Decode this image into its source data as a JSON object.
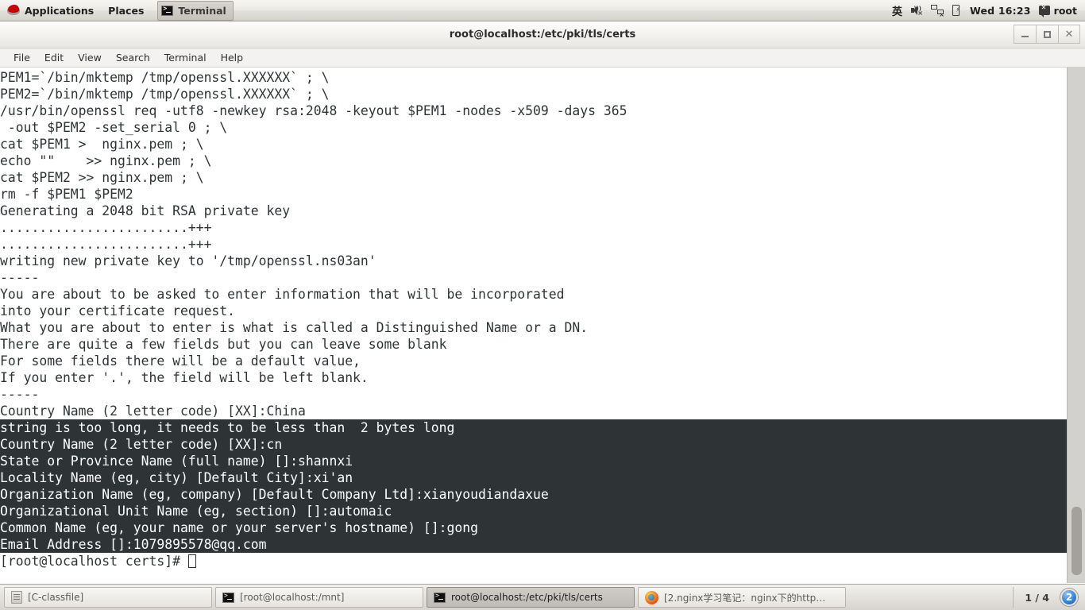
{
  "top_panel": {
    "applications_label": "Applications",
    "places_label": "Places",
    "active_task_label": "Terminal",
    "tray": {
      "ime_label": "英",
      "volume_icon": "volume-muted-icon",
      "network_icon": "network-disconnected-icon",
      "power_icon": "battery-charging-icon",
      "clock": "Wed 16:23",
      "user_label": "root",
      "user_icon": "chat-status-icon"
    }
  },
  "window": {
    "title": "root@localhost:/etc/pki/tls/certs",
    "buttons": {
      "minimize": "minimize-button",
      "maximize": "maximize-button",
      "close": "close-button"
    },
    "menubar": [
      "File",
      "Edit",
      "View",
      "Search",
      "Terminal",
      "Help"
    ]
  },
  "terminal": {
    "lines": [
      {
        "text": "PEM1=`/bin/mktemp /tmp/openssl.XXXXXX` ; \\",
        "selected": false
      },
      {
        "text": "PEM2=`/bin/mktemp /tmp/openssl.XXXXXX` ; \\",
        "selected": false
      },
      {
        "text": "/usr/bin/openssl req -utf8 -newkey rsa:2048 -keyout $PEM1 -nodes -x509 -days 365",
        "selected": false
      },
      {
        "text": " -out $PEM2 -set_serial 0 ; \\",
        "selected": false
      },
      {
        "text": "cat $PEM1 >  nginx.pem ; \\",
        "selected": false
      },
      {
        "text": "echo \"\"    >> nginx.pem ; \\",
        "selected": false
      },
      {
        "text": "cat $PEM2 >> nginx.pem ; \\",
        "selected": false
      },
      {
        "text": "rm -f $PEM1 $PEM2",
        "selected": false
      },
      {
        "text": "Generating a 2048 bit RSA private key",
        "selected": false
      },
      {
        "text": "........................+++",
        "selected": false
      },
      {
        "text": "........................+++",
        "selected": false
      },
      {
        "text": "writing new private key to '/tmp/openssl.ns03an'",
        "selected": false
      },
      {
        "text": "-----",
        "selected": false
      },
      {
        "text": "You are about to be asked to enter information that will be incorporated",
        "selected": false
      },
      {
        "text": "into your certificate request.",
        "selected": false
      },
      {
        "text": "What you are about to enter is what is called a Distinguished Name or a DN.",
        "selected": false
      },
      {
        "text": "There are quite a few fields but you can leave some blank",
        "selected": false
      },
      {
        "text": "For some fields there will be a default value,",
        "selected": false
      },
      {
        "text": "If you enter '.', the field will be left blank.",
        "selected": false
      },
      {
        "text": "-----",
        "selected": false
      },
      {
        "text": "Country Name (2 letter code) [XX]:China",
        "selected": false
      },
      {
        "text": "string is too long, it needs to be less than  2 bytes long",
        "selected": true
      },
      {
        "text": "Country Name (2 letter code) [XX]:cn",
        "selected": true
      },
      {
        "text": "State or Province Name (full name) []:shannxi",
        "selected": true
      },
      {
        "text": "Locality Name (eg, city) [Default City]:xi'an",
        "selected": true
      },
      {
        "text": "Organization Name (eg, company) [Default Company Ltd]:xianyoudiandaxue",
        "selected": true
      },
      {
        "text": "Organizational Unit Name (eg, section) []:automaic",
        "selected": true
      },
      {
        "text": "Common Name (eg, your name or your server's hostname) []:gong",
        "selected": true
      },
      {
        "text": "Email Address []:1079895578@qq.com",
        "selected": true
      }
    ],
    "prompt": "[root@localhost certs]# "
  },
  "taskbar": {
    "items": [
      {
        "label": "[C-classfile]",
        "icon": "file-manager-icon",
        "active": false
      },
      {
        "label": "[root@localhost:/mnt]",
        "icon": "terminal-icon",
        "active": false
      },
      {
        "label": "root@localhost:/etc/pki/tls/certs",
        "icon": "terminal-icon",
        "active": true
      },
      {
        "label": "[2.nginx学习笔记：nginx下的http…",
        "icon": "firefox-icon",
        "active": false
      }
    ],
    "workspace": "1 / 4",
    "notification_count": "2"
  },
  "colors": {
    "selection_bg": "#2e3436",
    "selection_fg": "#ffffff",
    "terminal_bg": "#ffffff",
    "terminal_fg": "#2e3436",
    "accent": "#cc0000"
  }
}
